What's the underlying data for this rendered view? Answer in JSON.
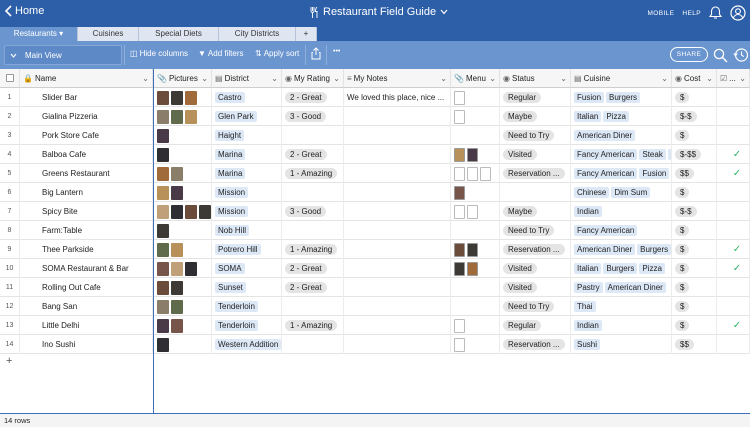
{
  "app": {
    "home_label": "Home",
    "title": "Restaurant Field Guide",
    "mobile_label": "MOBILE",
    "help_label": "HELP"
  },
  "tabs": [
    {
      "label": "Restaurants",
      "active": true
    },
    {
      "label": "Cuisines"
    },
    {
      "label": "Special Diets"
    },
    {
      "label": "City Districts"
    },
    {
      "label": "+"
    }
  ],
  "toolbar": {
    "view_label": "Main View",
    "hide_columns": "Hide columns",
    "add_filters": "Add filters",
    "apply_sort": "Apply sort",
    "more": "•••",
    "share": "SHARE"
  },
  "columns": {
    "name": "Name",
    "pictures": "Pictures",
    "district": "District",
    "rating": "My Rating",
    "notes": "My Notes",
    "menu": "Menu",
    "status": "Status",
    "cuisine": "Cuisine",
    "cost": "Cost",
    "visited": "..."
  },
  "rows": [
    {
      "num": "1",
      "name": "Slider Bar",
      "pictures": 3,
      "district": "Castro",
      "rating": "2 - Great",
      "notes": "We loved this place, nice ...",
      "menu": 1,
      "status": "Regular",
      "cuisine": [
        "Fusion",
        "Burgers"
      ],
      "cost": "$",
      "visited": false
    },
    {
      "num": "2",
      "name": "Gialina Pizzeria",
      "pictures": 3,
      "district": "Glen Park",
      "rating": "3 - Good",
      "notes": "",
      "menu": 1,
      "status": "Maybe",
      "cuisine": [
        "Italian",
        "Pizza"
      ],
      "cost": "$-$",
      "visited": false
    },
    {
      "num": "3",
      "name": "Pork Store Cafe",
      "pictures": 1,
      "district": "Haight",
      "rating": "",
      "notes": "",
      "menu": 0,
      "status": "Need to Try",
      "cuisine": [
        "American Diner"
      ],
      "cost": "$",
      "visited": false
    },
    {
      "num": "4",
      "name": "Balboa Cafe",
      "pictures": 1,
      "district": "Marina",
      "rating": "2 - Great",
      "notes": "",
      "menu": 2,
      "status": "Visited",
      "cuisine": [
        "Fancy American",
        "Steak",
        "E"
      ],
      "cost": "$-$$",
      "visited": true
    },
    {
      "num": "5",
      "name": "Greens Restaurant",
      "pictures": 2,
      "district": "Marina",
      "rating": "1 - Amazing",
      "notes": "",
      "menu": 3,
      "status": "Reservation ...",
      "cuisine": [
        "Fancy American",
        "Fusion"
      ],
      "cost": "$$",
      "visited": true
    },
    {
      "num": "6",
      "name": "Big Lantern",
      "pictures": 2,
      "district": "Mission",
      "rating": "",
      "notes": "",
      "menu": 1,
      "status": "",
      "cuisine": [
        "Chinese",
        "Dim Sum"
      ],
      "cost": "$",
      "visited": false
    },
    {
      "num": "7",
      "name": "Spicy Bite",
      "pictures": 4,
      "district": "Mission",
      "rating": "3 - Good",
      "notes": "",
      "menu": 2,
      "status": "Maybe",
      "cuisine": [
        "Indian"
      ],
      "cost": "$-$",
      "visited": false
    },
    {
      "num": "8",
      "name": "Farm:Table",
      "pictures": 1,
      "district": "Nob Hill",
      "rating": "",
      "notes": "",
      "menu": 0,
      "status": "Need to Try",
      "cuisine": [
        "Fancy American"
      ],
      "cost": "$",
      "visited": false
    },
    {
      "num": "9",
      "name": "Thee Parkside",
      "pictures": 2,
      "district": "Potrero Hill",
      "rating": "1 - Amazing",
      "notes": "",
      "menu": 2,
      "status": "Reservation ...",
      "cuisine": [
        "American Diner",
        "Burgers"
      ],
      "cost": "$",
      "visited": true
    },
    {
      "num": "10",
      "name": "SOMA Restaurant & Bar",
      "pictures": 3,
      "district": "SOMA",
      "rating": "2 - Great",
      "notes": "",
      "menu": 2,
      "status": "Visited",
      "cuisine": [
        "Italian",
        "Burgers",
        "Pizza"
      ],
      "cost": "$",
      "visited": true
    },
    {
      "num": "11",
      "name": "Rolling Out Cafe",
      "pictures": 2,
      "district": "Sunset",
      "rating": "2 - Great",
      "notes": "",
      "menu": 0,
      "status": "Visited",
      "cuisine": [
        "Pastry",
        "American Diner"
      ],
      "cost": "$",
      "visited": false
    },
    {
      "num": "12",
      "name": "Bang San",
      "pictures": 2,
      "district": "Tenderloin",
      "rating": "",
      "notes": "",
      "menu": 0,
      "status": "Need to Try",
      "cuisine": [
        "Thai"
      ],
      "cost": "$",
      "visited": false
    },
    {
      "num": "13",
      "name": "Little Delhi",
      "pictures": 2,
      "district": "Tenderloin",
      "rating": "1 - Amazing",
      "notes": "",
      "menu": 1,
      "status": "Regular",
      "cuisine": [
        "Indian"
      ],
      "cost": "$",
      "visited": true
    },
    {
      "num": "14",
      "name": "Ino Sushi",
      "pictures": 1,
      "district": "Western Addition",
      "rating": "",
      "notes": "",
      "menu": 1,
      "status": "Reservation ...",
      "cuisine": [
        "Sushi"
      ],
      "cost": "$$",
      "visited": false
    }
  ],
  "footer": {
    "row_count": "14 rows",
    "add_row": "+"
  },
  "colors": {
    "header_blue": "#2d5fa8",
    "toolbar_blue": "#6b95cf",
    "chip_blue": "#dde8f7",
    "check_green": "#2fb36b"
  }
}
